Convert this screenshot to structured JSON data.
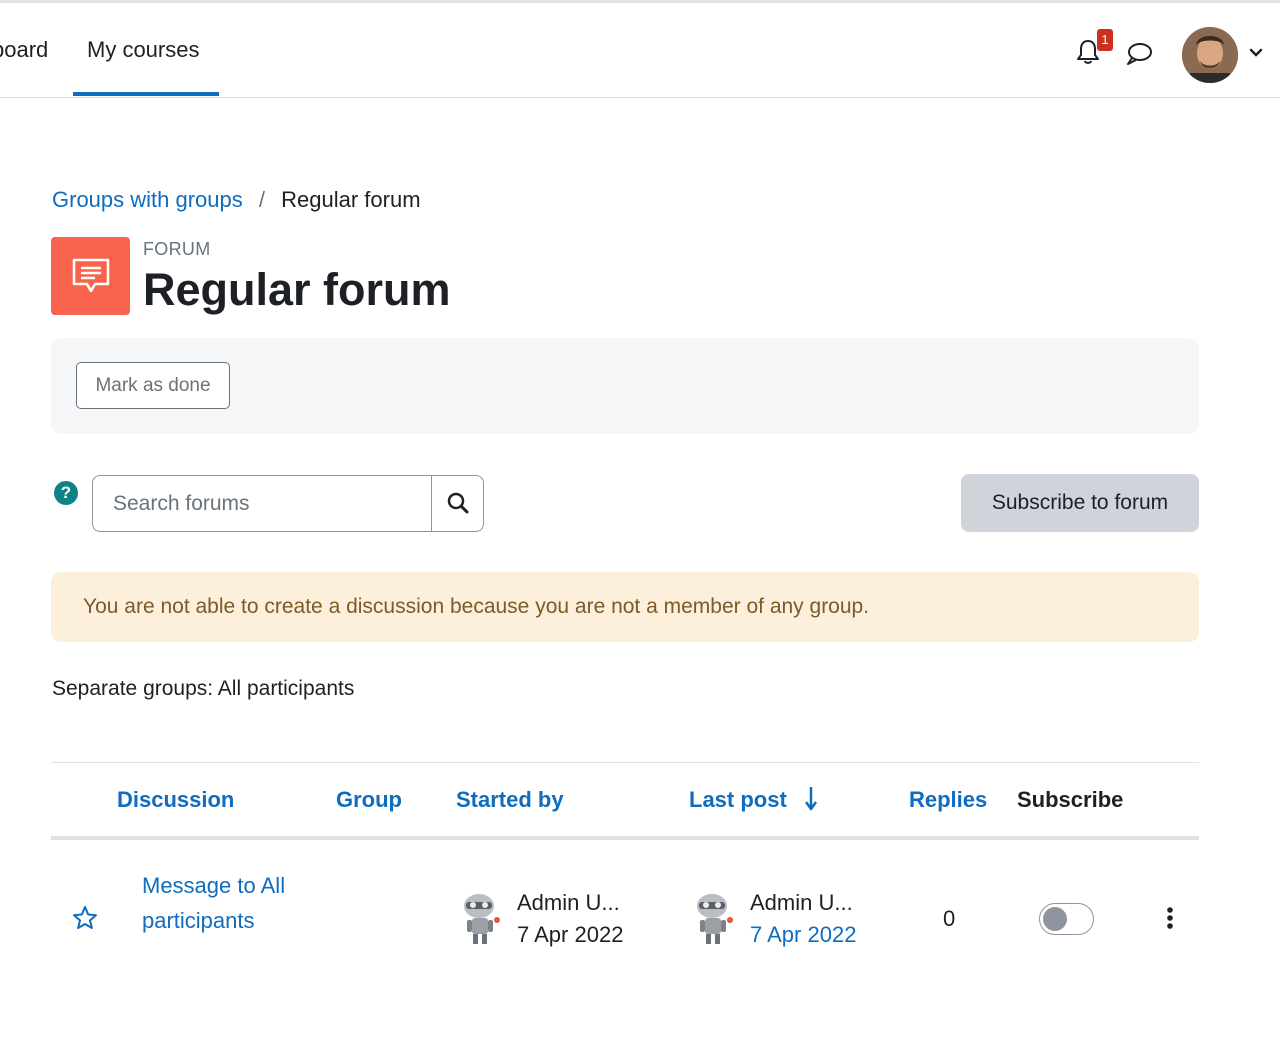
{
  "nav": {
    "dashboard": "board",
    "my_courses": "My courses",
    "notification_count": "1"
  },
  "breadcrumb": {
    "parent": "Groups with groups",
    "separator": "/",
    "current": "Regular forum"
  },
  "header": {
    "activity_type": "FORUM",
    "title": "Regular forum",
    "icon_color": "#f7634d"
  },
  "activity": {
    "mark_done_label": "Mark as done"
  },
  "search": {
    "placeholder": "Search forums"
  },
  "subscribe_label": "Subscribe to forum",
  "alert_text": "You are not able to create a discussion because you are not a member of any group.",
  "groups_text": "Separate groups: All participants",
  "table": {
    "columns": [
      "Discussion",
      "Group",
      "Started by",
      "Last post",
      "Replies",
      "Subscribe"
    ],
    "rows": [
      {
        "discussion": "Message to All participants",
        "group": "",
        "started_by_name": "Admin U...",
        "started_by_date": "7 Apr 2022",
        "last_post_name": "Admin U...",
        "last_post_date": "7 Apr 2022",
        "replies": "0",
        "subscribed": false
      }
    ]
  },
  "colors": {
    "link": "#0f6cbf",
    "alert_bg": "#fcefdc",
    "alert_text": "#7d5a29",
    "badge": "#ca3120"
  }
}
